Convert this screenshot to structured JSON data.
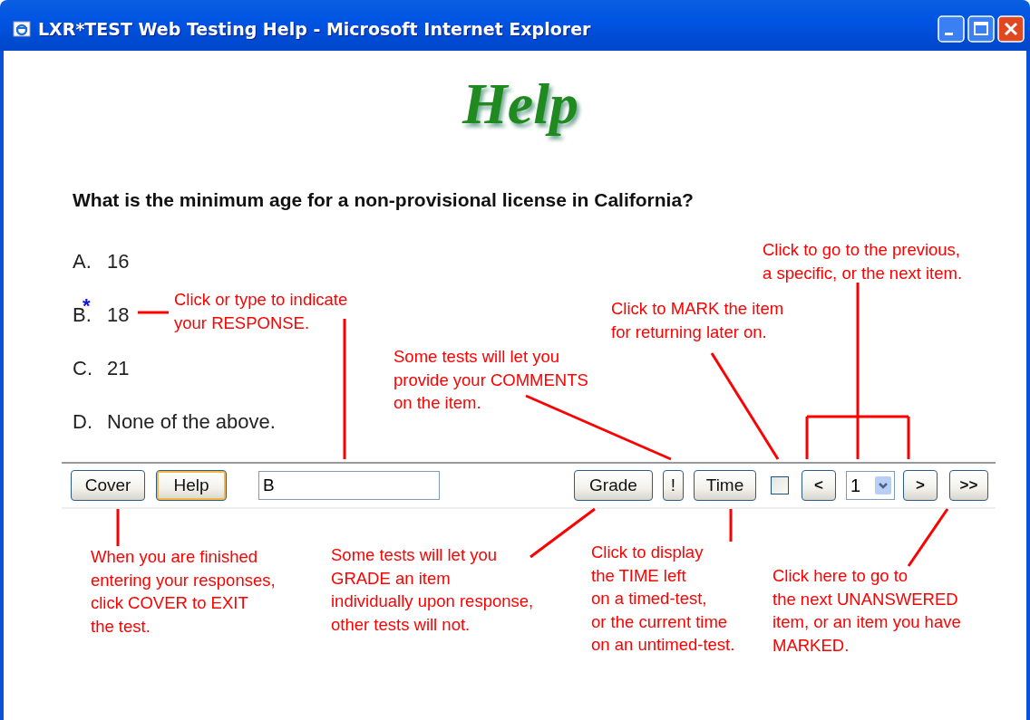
{
  "window": {
    "title": "LXR*TEST Web Testing Help - Microsoft Internet Explorer"
  },
  "logo": "Help",
  "question": "What is the minimum age for a non-provisional license in California?",
  "selected_marker": "*",
  "answers": [
    {
      "letter": "A.",
      "text": "16",
      "selected": false
    },
    {
      "letter": "B.",
      "text": "18",
      "selected": true
    },
    {
      "letter": "C.",
      "text": "21",
      "selected": false
    },
    {
      "letter": "D.",
      "text": "None of the above.",
      "selected": false
    }
  ],
  "toolbar": {
    "left_buttons": [
      {
        "label": "Cover",
        "focused": false
      },
      {
        "label": "Help",
        "focused": true
      }
    ],
    "response": {
      "value": "B"
    },
    "right_buttons": [
      {
        "label": "Grade"
      },
      {
        "label": "!"
      },
      {
        "label": "Time"
      }
    ],
    "mark_checkbox": {
      "checked": false
    },
    "prev": "<",
    "item_select": {
      "value": "1"
    },
    "next": ">",
    "next_unanswered": ">>"
  },
  "annotations": [
    {
      "lines": [
        "Click or type to indicate",
        "your RESPONSE."
      ]
    },
    {
      "lines": [
        "Some tests will let you",
        "provide your COMMENTS",
        "on the item."
      ]
    },
    {
      "lines": [
        "Click to MARK the item",
        "for returning later on."
      ]
    },
    {
      "lines": [
        "Click to go to the previous,",
        "a specific, or the next item."
      ]
    },
    {
      "lines": [
        "When you are finished",
        "entering your responses,",
        "click COVER to EXIT",
        "the test."
      ]
    },
    {
      "lines": [
        "Some tests will let you",
        "GRADE an item",
        "individually upon response,",
        "other tests will not."
      ]
    },
    {
      "lines": [
        "Click to display",
        "the TIME left",
        "on a timed-test,",
        "or the current time",
        "on an untimed-test."
      ]
    },
    {
      "lines": [
        "Click here to go to",
        "the next UNANSWERED",
        "item, or an item you have",
        "MARKED."
      ]
    }
  ]
}
